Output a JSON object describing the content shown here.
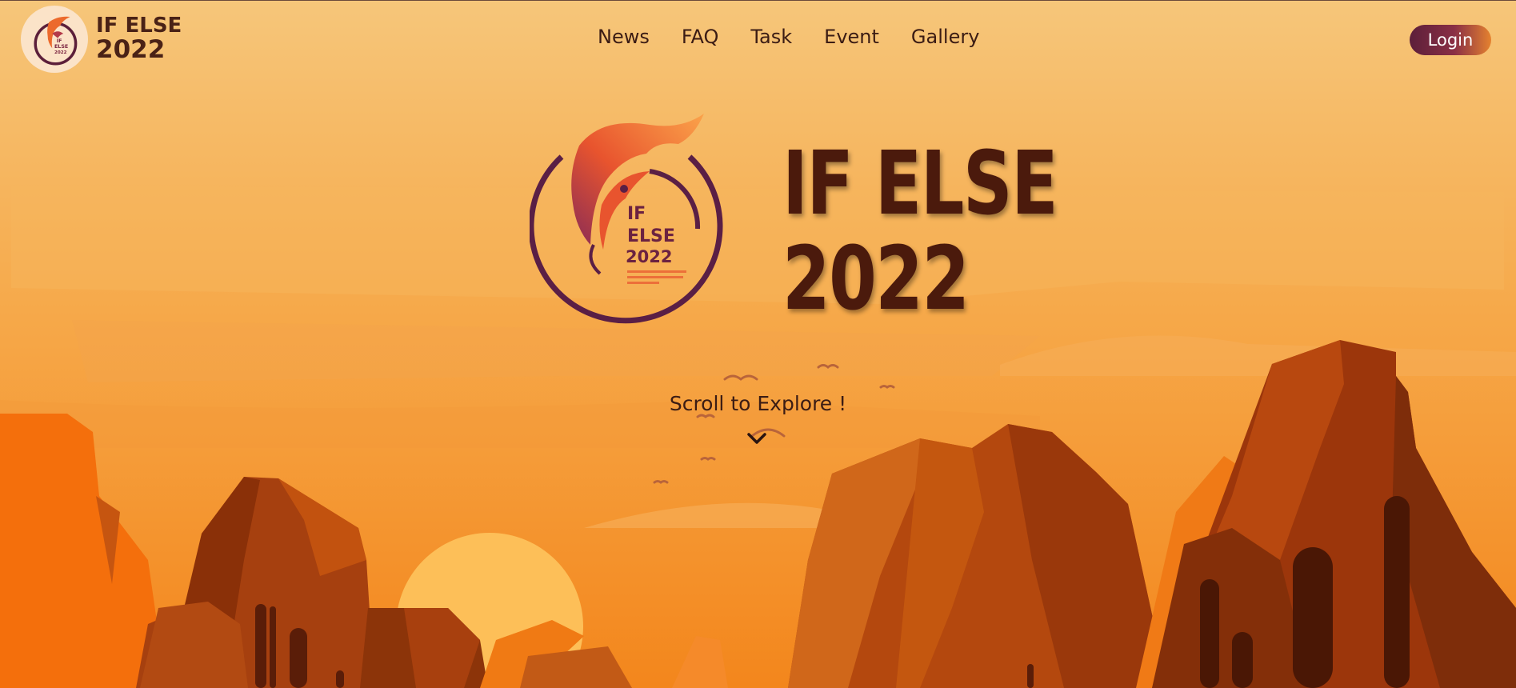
{
  "brand": {
    "line1": "IF ELSE",
    "line2": "2022"
  },
  "nav": {
    "items": [
      "News",
      "FAQ",
      "Task",
      "Event",
      "Gallery"
    ]
  },
  "login": {
    "label": "Login"
  },
  "hero": {
    "title_line1": "IF ELSE",
    "title_line2": "2022",
    "logo_text": [
      "IF",
      "ELSE",
      "2022"
    ]
  },
  "scroll": {
    "label": "Scroll to Explore !"
  },
  "colors": {
    "sky_top": "#f6c67a",
    "sky_bottom": "#f28a1e",
    "sun": "#fdbf58",
    "rock_dark": "#7a2a0a",
    "rock_mid": "#b0440f",
    "title": "#4b1a0c",
    "login_gradient_start": "#5c1f3a",
    "login_gradient_end": "#e5822f"
  },
  "icons": {
    "scroll": "chevron-down-icon",
    "logo": "phoenix-logo-icon"
  }
}
